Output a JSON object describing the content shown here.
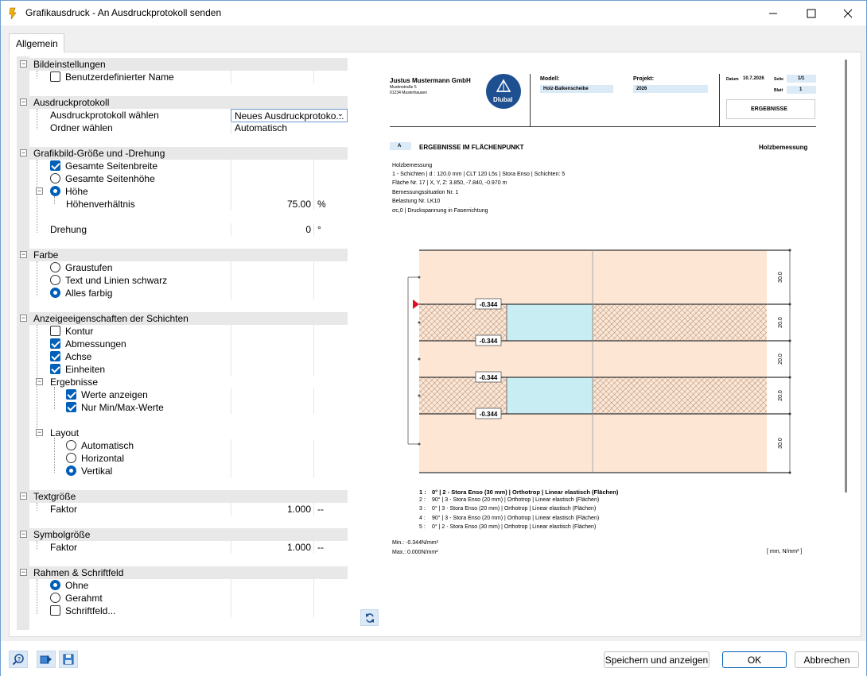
{
  "window": {
    "title": "Grafikausdruck - An Ausdruckprotokoll senden",
    "minimize_icon": "minimize-icon",
    "maximize_icon": "maximize-icon",
    "close_icon": "close-icon"
  },
  "tabs": [
    {
      "label": "Allgemein"
    }
  ],
  "tree": {
    "bildeinstellungen": {
      "label": "Bildeinstellungen",
      "benutzerdefinierter": "Benutzerdefinierter Name"
    },
    "ausdruckprotokoll": {
      "label": "Ausdruckprotokoll",
      "waehlen": "Ausdruckprotokoll wählen",
      "waehlen_value": "Neues Ausdruckprotoko...",
      "ordner": "Ordner wählen",
      "ordner_value": "Automatisch"
    },
    "groesse": {
      "label": "Grafikbild-Größe und -Drehung",
      "seitenbreite": "Gesamte Seitenbreite",
      "seitenhoehe": "Gesamte Seitenhöhe",
      "hoehe": "Höhe",
      "verhaeltnis": "Höhenverhältnis",
      "verhaeltnis_value": "75.00",
      "verhaeltnis_unit": "%",
      "drehung": "Drehung",
      "drehung_value": "0",
      "drehung_unit": "°"
    },
    "farbe": {
      "label": "Farbe",
      "graustufen": "Graustufen",
      "schwarz": "Text und Linien schwarz",
      "farbig": "Alles farbig"
    },
    "schichten": {
      "label": "Anzeigeeigenschaften der Schichten",
      "kontur": "Kontur",
      "abmessungen": "Abmessungen",
      "achse": "Achse",
      "einheiten": "Einheiten",
      "ergebnisse": "Ergebnisse",
      "werte": "Werte anzeigen",
      "minmax": "Nur Min/Max-Werte",
      "layout": "Layout",
      "automatisch": "Automatisch",
      "horizontal": "Horizontal",
      "vertikal": "Vertikal"
    },
    "textgroesse": {
      "label": "Textgröße",
      "faktor": "Faktor",
      "faktor_value": "1.000",
      "faktor_unit": "--"
    },
    "symbolgroesse": {
      "label": "Symbolgröße",
      "faktor": "Faktor",
      "faktor_value": "1.000",
      "faktor_unit": "--"
    },
    "rahmen": {
      "label": "Rahmen & Schriftfeld",
      "ohne": "Ohne",
      "gerahmt": "Gerahmt",
      "schriftfeld": "Schriftfeld..."
    }
  },
  "preview": {
    "company": "Justus Mustermann GmbH",
    "street": "Musterstraße 5",
    "city": "01234 Musterhausen",
    "logo_text": "Dlubal",
    "modell_label": "Modell:",
    "modell_value": "Holz-Balkenscheibe",
    "projekt_label": "Projekt:",
    "projekt_value": "2026",
    "datum_label": "Datum",
    "datum_value": "10.7.2026",
    "seite_label": "Seite",
    "seite_value": "1/1",
    "blatt_label": "Blatt",
    "blatt_value": "1",
    "ergebnisse_box": "ERGEBNISSE",
    "section_badge": "A",
    "section_title": "ERGEBNISSE IM FLÄCHENPUNKT",
    "section_right": "Holzbemessung",
    "info": [
      "Holzbemessung",
      "1 - Schichten | d : 120.0 mm | CLT 120 L5s | Stora Enso | Schichten: 5",
      "Fläche Nr. 17 | X, Y, Z: 3.850, -7.840, -0.970 m",
      "Bemessungssituation Nr. 1",
      "Belastung Nr. LK10",
      "σc,0 | Druckspannung in Faserrichtung"
    ],
    "values": [
      "-0.344",
      "-0.344",
      "-0.344",
      "-0.344"
    ],
    "dims": [
      "30.0",
      "20.0",
      "20.0",
      "20.0",
      "30.0"
    ],
    "layers": [
      {
        "no": "1 :",
        "text": "0° | 2 - Stora Enso (30 mm) | Orthotrop | Linear elastisch (Flächen)"
      },
      {
        "no": "2 :",
        "text": "90° | 3 - Stora Enso (20 mm) | Orthotrop | Linear elastisch (Flächen)"
      },
      {
        "no": "3 :",
        "text": "0° | 3 - Stora Enso (20 mm) | Orthotrop | Linear elastisch (Flächen)"
      },
      {
        "no": "4 :",
        "text": "90° | 3 - Stora Enso (20 mm) | Orthotrop | Linear elastisch (Flächen)"
      },
      {
        "no": "5 :",
        "text": "0° | 2 - Stora Enso (30 mm) | Orthotrop | Linear elastisch (Flächen)"
      }
    ],
    "min": "Min.: -0.344N/mm²",
    "max": "Max.: 0.000N/mm²",
    "units": "[ mm, N/mm² ]"
  },
  "buttons": {
    "save_show": "Speichern und anzeigen",
    "ok": "OK",
    "cancel": "Abbrechen"
  }
}
